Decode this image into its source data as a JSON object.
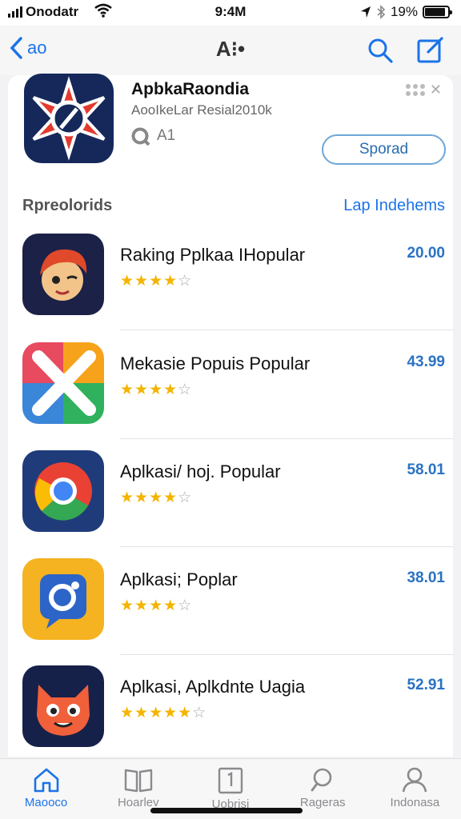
{
  "status": {
    "carrier": "Onodatr",
    "time": "9:4M",
    "battery": "19%",
    "battery_level": 0.9
  },
  "nav": {
    "back_label": "ao",
    "title": "A⁝•",
    "search_icon": "search-icon",
    "compose_icon": "compose-icon"
  },
  "featured": {
    "name": "ApbkaRaondia",
    "subtitle": "AooIkeLar Resial2010k",
    "rating_label": "A1",
    "action_label": "Sporad",
    "accent": "#1a73e8"
  },
  "section": {
    "title": "Rpreolorids",
    "link": "Lap Indehems"
  },
  "apps": [
    {
      "name": "Raking Pplkaa IHopular",
      "price": "20.00",
      "rating": 4.5,
      "stars": "★★★★",
      "stars_off": "☆",
      "icon": "cartoon-character-icon"
    },
    {
      "name": "Mekasie Popuis Popular",
      "price": "43.99",
      "rating": 4,
      "stars": "★★★★",
      "stars_off": "☆",
      "icon": "colorful-x-icon"
    },
    {
      "name": "Aplkasi/ hoj. Popular",
      "price": "58.01",
      "rating": 4,
      "stars": "★★★★",
      "stars_off": "☆",
      "icon": "browser-ring-icon"
    },
    {
      "name": "Aplkasi; Poplar",
      "price": "38.01",
      "rating": 4,
      "stars": "★★★★",
      "stars_off": "☆",
      "icon": "chat-bubble-icon"
    },
    {
      "name": "Aplkasi, Aplkdnte Uagia",
      "price": "52.91",
      "rating": 4.5,
      "stars": "★★★★★",
      "stars_off": "☆",
      "icon": "fox-face-icon"
    }
  ],
  "tabs": [
    {
      "label": "Maooco",
      "icon": "home-icon"
    },
    {
      "label": "Hoarlev",
      "icon": "book-icon"
    },
    {
      "label": "Uobrisi",
      "icon": "updates-icon"
    },
    {
      "label": "Rageras",
      "icon": "search-icon"
    },
    {
      "label": "Indonasa",
      "icon": "profile-icon"
    }
  ]
}
